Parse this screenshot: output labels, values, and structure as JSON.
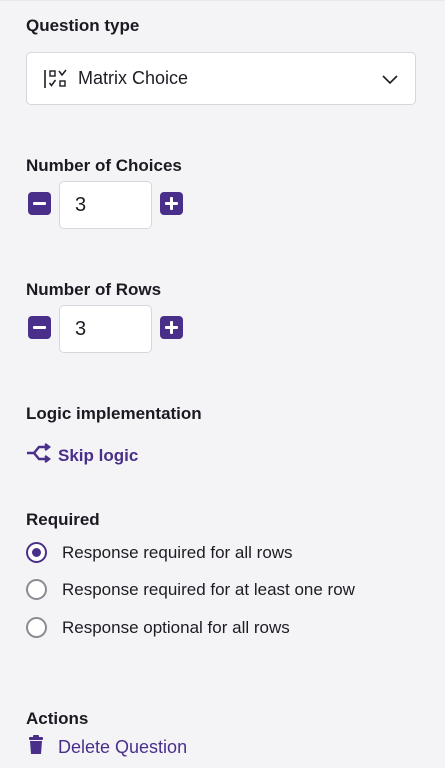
{
  "question_type": {
    "heading": "Question type",
    "selected": "Matrix Choice",
    "icon": "matrix-choice-icon"
  },
  "num_choices": {
    "heading": "Number of Choices",
    "value": "3"
  },
  "num_rows": {
    "heading": "Number of Rows",
    "value": "3"
  },
  "logic": {
    "heading": "Logic implementation",
    "link_label": "Skip logic",
    "icon": "shuffle-icon"
  },
  "required": {
    "heading": "Required",
    "options": [
      {
        "label": "Response required for all rows",
        "checked": true
      },
      {
        "label": "Response required for at least one row",
        "checked": false
      },
      {
        "label": "Response optional for all rows",
        "checked": false
      }
    ]
  },
  "actions": {
    "heading": "Actions",
    "delete_label": "Delete Question",
    "icon": "trash-icon"
  },
  "colors": {
    "accent": "#4a2f8a",
    "background": "#f4f4f6"
  }
}
